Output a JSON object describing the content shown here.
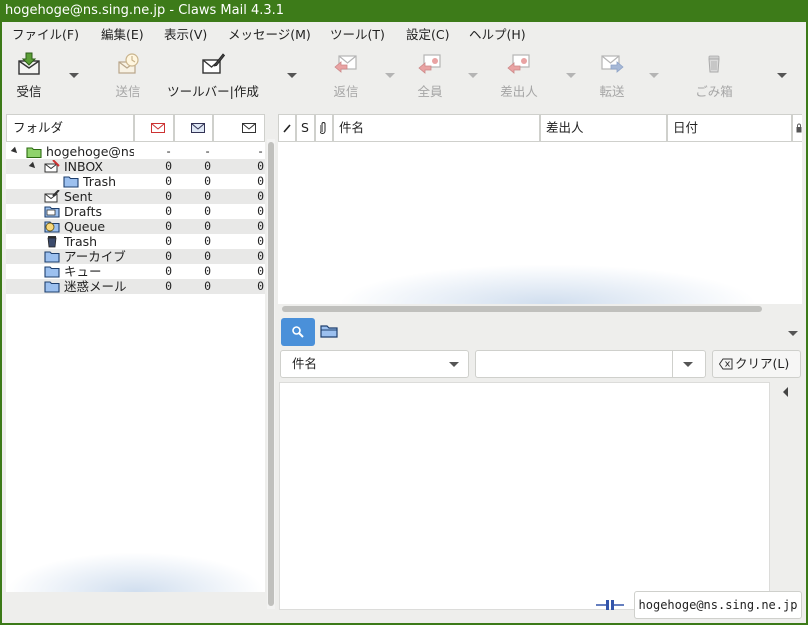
{
  "window": {
    "title": "hogehoge@ns.sing.ne.jp - Claws Mail 4.3.1"
  },
  "menubar": {
    "items": [
      {
        "label": "ファイル(F)"
      },
      {
        "label": "編集(E)"
      },
      {
        "label": "表示(V)"
      },
      {
        "label": "メッセージ(M)"
      },
      {
        "label": "ツール(T)"
      },
      {
        "label": "設定(C)"
      },
      {
        "label": "ヘルプ(H)"
      }
    ]
  },
  "toolbar": {
    "receive": "受信",
    "send": "送信",
    "compose": "ツールバー|作成",
    "reply": "返信",
    "reply_all": "全員",
    "reply_sender": "差出人",
    "forward": "転送",
    "trash": "ごみ箱"
  },
  "folders": {
    "header": {
      "name": "フォルダ"
    },
    "rows": [
      {
        "name": "hogehoge@ns",
        "new": "-",
        "unread": "-",
        "total": "-",
        "icon": "account-icon"
      },
      {
        "name": "INBOX",
        "new": "0",
        "unread": "0",
        "total": "0",
        "icon": "inbox-icon"
      },
      {
        "name": "Trash",
        "new": "0",
        "unread": "0",
        "total": "0",
        "icon": "folder-icon"
      },
      {
        "name": "Sent",
        "new": "0",
        "unread": "0",
        "total": "0",
        "icon": "sent-icon"
      },
      {
        "name": "Drafts",
        "new": "0",
        "unread": "0",
        "total": "0",
        "icon": "drafts-icon"
      },
      {
        "name": "Queue",
        "new": "0",
        "unread": "0",
        "total": "0",
        "icon": "queue-icon"
      },
      {
        "name": "Trash",
        "new": "0",
        "unread": "0",
        "total": "0",
        "icon": "trash-icon"
      },
      {
        "name": "アーカイブ",
        "new": "0",
        "unread": "0",
        "total": "0",
        "icon": "folder-icon"
      },
      {
        "name": "キュー",
        "new": "0",
        "unread": "0",
        "total": "0",
        "icon": "folder-icon"
      },
      {
        "name": "迷惑メール",
        "new": "0",
        "unread": "0",
        "total": "0",
        "icon": "folder-icon"
      }
    ]
  },
  "messagelist": {
    "columns": {
      "status": "S",
      "subject": "件名",
      "from": "差出人",
      "date": "日付"
    }
  },
  "quicksearch": {
    "field_type": "件名",
    "value": "",
    "clear_label": "クリア(L)"
  },
  "statusbar": {
    "account": "hogehoge@ns.sing.ne.jp"
  },
  "colors": {
    "titlebar": "#3d7b19",
    "search_active": "#4a90d9"
  }
}
